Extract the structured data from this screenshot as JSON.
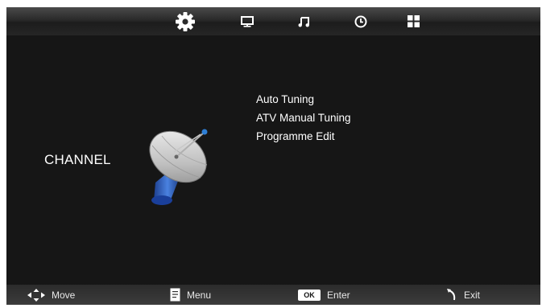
{
  "tabs": [
    {
      "id": "channel",
      "icon": "gear-icon",
      "selected": true
    },
    {
      "id": "picture",
      "icon": "monitor-icon",
      "selected": false
    },
    {
      "id": "sound",
      "icon": "music-note-icon",
      "selected": false
    },
    {
      "id": "time",
      "icon": "clock-icon",
      "selected": false
    },
    {
      "id": "setup",
      "icon": "grid-icon",
      "selected": false
    }
  ],
  "section": {
    "title": "CHANNEL",
    "icon": "satellite-dish-icon"
  },
  "menu": {
    "items": [
      {
        "label": "Auto Tuning"
      },
      {
        "label": "ATV Manual Tuning"
      },
      {
        "label": "Programme Edit"
      }
    ]
  },
  "footer": {
    "move": {
      "icon": "direction-arrows-icon",
      "label": "Move"
    },
    "menu": {
      "icon": "menu-page-icon",
      "label": "Menu"
    },
    "enter": {
      "key": "OK",
      "label": "Enter"
    },
    "exit": {
      "icon": "return-arrow-icon",
      "label": "Exit"
    }
  },
  "colors": {
    "background": "#161616",
    "text": "#ffffff",
    "bar": "#2b2b2b"
  }
}
